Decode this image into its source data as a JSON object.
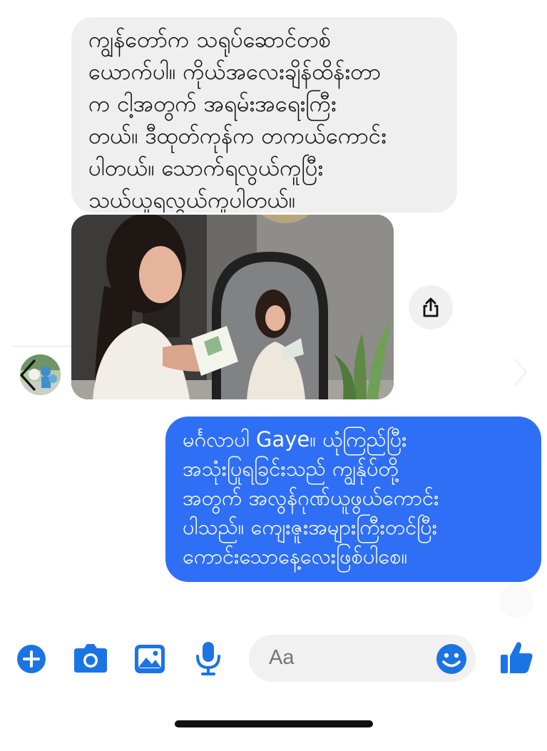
{
  "thread": {
    "received_message": "ကျွန်တော်က သရုပ်ဆောင်တစ်\nယောက်ပါ။ ကိုယ်အလေးချိန်ထိန်းတာ\nက ငါ့အတွက် အရမ်းအရေးကြီး\nတယ်။ ဒီထုတ်ကုန်က တကယ်ကောင်း\nပါတယ်။ သောက်ရလွယ်ကူပြီး\nသယ်ယူရလွယ်ကူပါတယ်။",
    "sent_message": "မင်္ဂလာပါ Gaye။ ယုံကြည်ပြီး\nအသုံးပြုရခြင်းသည် ကျွန်ုပ်တို့\nအတွက် အလွန်ဂုဏ်ယူဖွယ်ကောင်း\nပါသည်။ ကျေးဇူးအများကြီးတင်ပြီး\nကောင်းသောနေ့လေးဖြစ်ပါစေ။"
  },
  "composer": {
    "input_placeholder": "Aa",
    "icons": [
      "plus-icon",
      "camera-icon",
      "gallery-icon",
      "microphone-icon",
      "emoji-icon",
      "thumbs-up-icon"
    ]
  },
  "colors": {
    "accent": "#1b74e4",
    "sent_bubble": "#2f6ff6",
    "received_bubble": "#efefef"
  }
}
